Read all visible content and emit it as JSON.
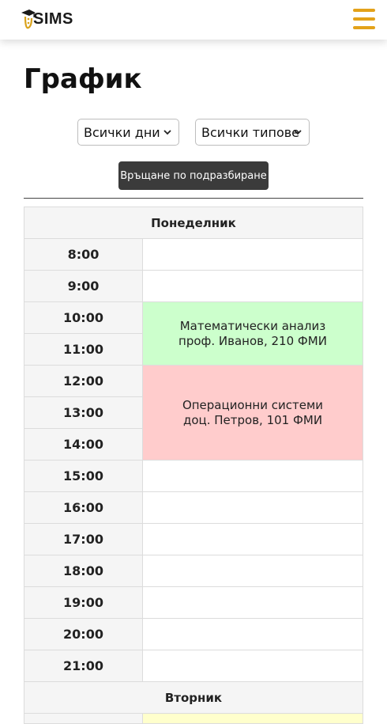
{
  "header": {
    "logo_text": "SIMS",
    "logo_icon": "graduation-cap-logo",
    "menu_icon": "hamburger-menu-icon",
    "accent_color": "#e3a21a"
  },
  "page": {
    "title": "График"
  },
  "filters": {
    "day_select": "Всички дни",
    "type_select": "Всички типове",
    "reset_label": "Връщане по подразбиране"
  },
  "schedule": {
    "monday": {
      "day": "Понеделник",
      "times": [
        "8:00",
        "9:00",
        "10:00",
        "11:00",
        "12:00",
        "13:00",
        "14:00",
        "15:00",
        "16:00",
        "17:00",
        "18:00",
        "19:00",
        "20:00",
        "21:00"
      ],
      "events": [
        {
          "name": "Математически анализ",
          "details": "проф. Иванов, 210 ФМИ",
          "start": "10:00",
          "end": "12:00",
          "color": "#ccffcc"
        },
        {
          "name": "Операционни системи",
          "details": "доц. Петров, 101 ФМИ",
          "start": "12:00",
          "end": "15:00",
          "color": "#ffcccc"
        }
      ]
    },
    "tuesday": {
      "day": "Вторник",
      "event_color": "#ffffcc"
    }
  }
}
